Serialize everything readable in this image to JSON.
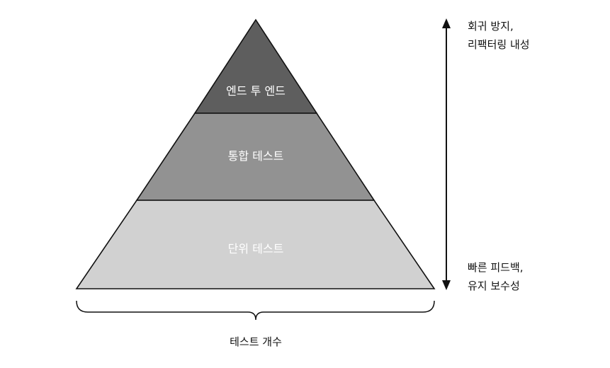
{
  "pyramid": {
    "layers": [
      {
        "label": "엔드 투 엔드",
        "fill": "#5e5e5e"
      },
      {
        "label": "통합 테스트",
        "fill": "#929292"
      },
      {
        "label": "단위 테스트",
        "fill": "#d1d1d1"
      }
    ]
  },
  "axis": {
    "top_label_line1": "회귀 방지,",
    "top_label_line2": "리팩터링 내성",
    "bottom_label_line1": "빠른 피드백,",
    "bottom_label_line2": "유지 보수성"
  },
  "base": {
    "label": "테스트 개수"
  },
  "colors": {
    "stroke": "#111111",
    "text_dark": "#111111",
    "text_light": "#ffffff"
  }
}
